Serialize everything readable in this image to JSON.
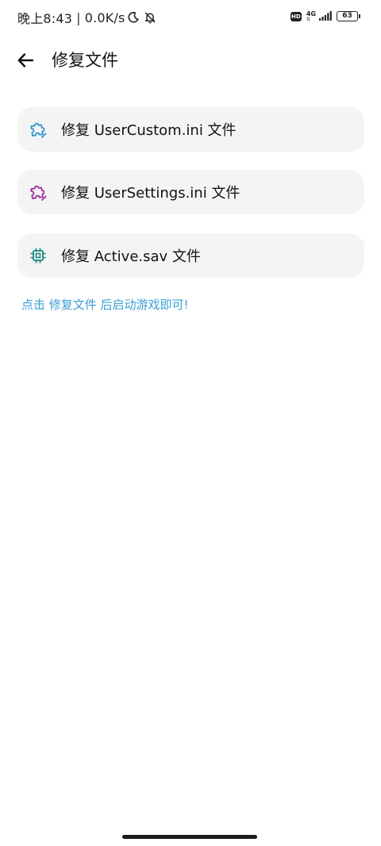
{
  "status_bar": {
    "time": "晚上8:43",
    "separator": "|",
    "net_speed": "0.0K/s",
    "hd": "HD",
    "network": "4G",
    "battery": "63",
    "icons": [
      "moon-icon",
      "bell-off-icon",
      "signal-icon",
      "battery-icon"
    ]
  },
  "app_bar": {
    "title": "修复文件",
    "back_icon": "arrow-left-icon"
  },
  "items": [
    {
      "label": "修复 UserCustom.ini 文件",
      "icon": "puzzle-icon",
      "color": "#2f93c9"
    },
    {
      "label": "修复 UserSettings.ini 文件",
      "icon": "puzzle-icon",
      "color": "#9b2d9e"
    },
    {
      "label": "修复 Active.sav 文件",
      "icon": "chip-icon",
      "color": "#16877c"
    }
  ],
  "hint": "点击 修复文件 后启动游戏即可!",
  "colors": {
    "background": "#ffffff",
    "card": "#f4f4f5",
    "hint": "#3a9fd6"
  }
}
